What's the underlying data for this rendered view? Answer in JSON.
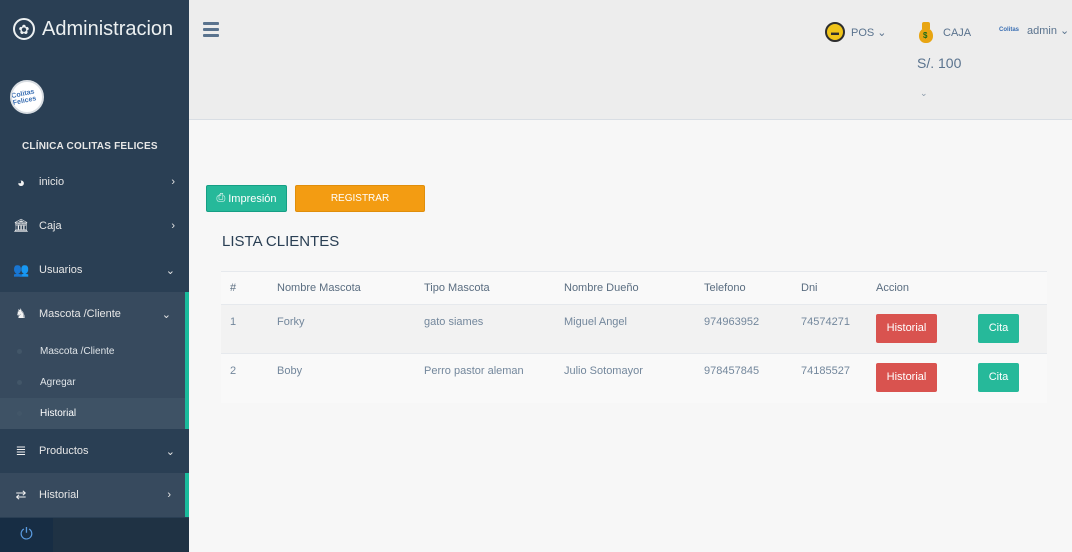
{
  "brand": {
    "title": "Administracion",
    "icon": "gear-icon"
  },
  "profile": {
    "logo_text": "Colitas Felices",
    "clinic_name": "CLÍNICA COLITAS FELICES"
  },
  "sidebar": {
    "items": [
      {
        "label": "inicio",
        "icon": "dashboard-icon",
        "chevron": "›"
      },
      {
        "label": "Caja",
        "icon": "bank-icon",
        "chevron": "›"
      },
      {
        "label": "Usuarios",
        "icon": "users-icon",
        "chevron": "⌄"
      },
      {
        "label": "Mascota /Cliente",
        "icon": "pet-client-icon",
        "chevron": "⌄"
      },
      {
        "label": "Productos",
        "icon": "database-icon",
        "chevron": "⌄"
      },
      {
        "label": "Historial",
        "icon": "history-icon",
        "chevron": "›"
      }
    ],
    "submenu": [
      "Mascota /Cliente",
      "Agregar",
      "Historial"
    ],
    "power_icon": "⏻"
  },
  "topnav": {
    "pos_label": "POS ⌄",
    "caja_label": "CAJA",
    "caja_amount": "S/. 100",
    "caja_chevron": "⌄",
    "admin_label": "admin ⌄",
    "admin_logo": "Colitas"
  },
  "actions": {
    "print_label": "Impresión",
    "register_label": "REGISTRAR"
  },
  "list_title": "LISTA CLIENTES",
  "table": {
    "headers": [
      "#",
      "Nombre Mascota",
      "Tipo Mascota",
      "Nombre Dueño",
      "Telefono",
      "Dni",
      "Accion"
    ],
    "rows": [
      {
        "num": "1",
        "pet": "Forky",
        "type": "gato siames",
        "owner": "Miguel Angel",
        "phone": "974963952",
        "dni": "74574271",
        "history_label": "Historial",
        "cita_label": "Cita"
      },
      {
        "num": "2",
        "pet": "Boby",
        "type": "Perro pastor aleman",
        "owner": "Julio Sotomayor",
        "phone": "978457845",
        "dni": "74185527",
        "history_label": "Historial",
        "cita_label": "Cita"
      }
    ]
  },
  "colors": {
    "sidebar": "#2a3f54",
    "accent": "#1abb9c",
    "success": "#26b99a",
    "warning": "#f39c12",
    "danger": "#d9534f"
  }
}
